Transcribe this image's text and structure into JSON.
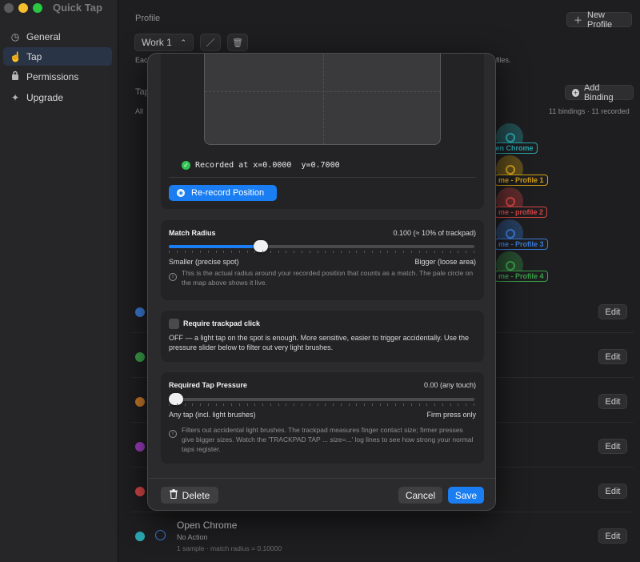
{
  "window": {
    "title": "Quick Tap"
  },
  "sidebar": {
    "items": [
      {
        "label": "General",
        "icon": "gauge-icon"
      },
      {
        "label": "Tap",
        "icon": "hand-tap-icon"
      },
      {
        "label": "Permissions",
        "icon": "lock-icon"
      },
      {
        "label": "Upgrade",
        "icon": "sparkle-icon"
      }
    ],
    "active": "Tap"
  },
  "main": {
    "profile_label": "Profile",
    "new_profile_label": "New Profile",
    "profile_select": "Work 1",
    "profile_hint_left": "Each",
    "profile_hint_right": "files.",
    "taps_label": "Tap",
    "add_binding_label": "Add Binding",
    "all_label": "All",
    "bindings_count": "11 bindings · 11 recorded",
    "map_labels": [
      {
        "text": "Open Chrome",
        "color": "#2aa7b0"
      },
      {
        "text": "me - Profile 1",
        "color": "#d4a017"
      },
      {
        "text": "me - profile 2",
        "color": "#d64545"
      },
      {
        "text": "me - Profile 3",
        "color": "#3a7bd5"
      },
      {
        "text": "me - Profile 4",
        "color": "#3aa14a"
      }
    ],
    "rows": [
      {
        "color": "#3a7bd5",
        "edit": "Edit"
      },
      {
        "color": "#3aa14a",
        "edit": "Edit"
      },
      {
        "color": "#c77a2a",
        "edit": "Edit"
      },
      {
        "color": "#9b3dbd",
        "edit": "Edit"
      },
      {
        "color": "#d64545",
        "edit": "Edit"
      }
    ],
    "last_row": {
      "title": "Open Chrome",
      "action": "No Action",
      "meta": "1 sample  ·  match radius = 0.10000",
      "edit": "Edit",
      "color": "#2aa7b0"
    }
  },
  "sheet": {
    "recorded_text": "Recorded at x=0.0000  y=0.7000",
    "rerecord_label": "Re-record Position",
    "match_radius": {
      "title": "Match Radius",
      "value_text": "0.100  (≈ 10% of trackpad)",
      "value": 0.29,
      "left_label": "Smaller (precise spot)",
      "right_label": "Bigger (loose area)",
      "help": "This is the actual radius around your recorded position that counts as a match. The pale circle on the map above shows it live."
    },
    "trackpad_click": {
      "label": "Require trackpad click",
      "checked": false,
      "description": "OFF — a light tap on the spot is enough. More sensitive, easier to trigger accidentally. Use the pressure slider below to filter out very light brushes."
    },
    "pressure": {
      "title": "Required Tap Pressure",
      "value_text": "0.00  (any touch)",
      "value": 0.0,
      "left_label": "Any tap (incl. light brushes)",
      "right_label": "Firm press only",
      "help": "Filters out accidental light brushes. The trackpad measures finger contact size; firmer presses give bigger sizes. Watch the 'TRACKPAD TAP ... size=...' log lines to see how strong your normal taps register."
    },
    "delete_label": "Delete",
    "cancel_label": "Cancel",
    "save_label": "Save"
  },
  "colors": {
    "accent": "#1a7ef2",
    "success": "#30c452"
  }
}
